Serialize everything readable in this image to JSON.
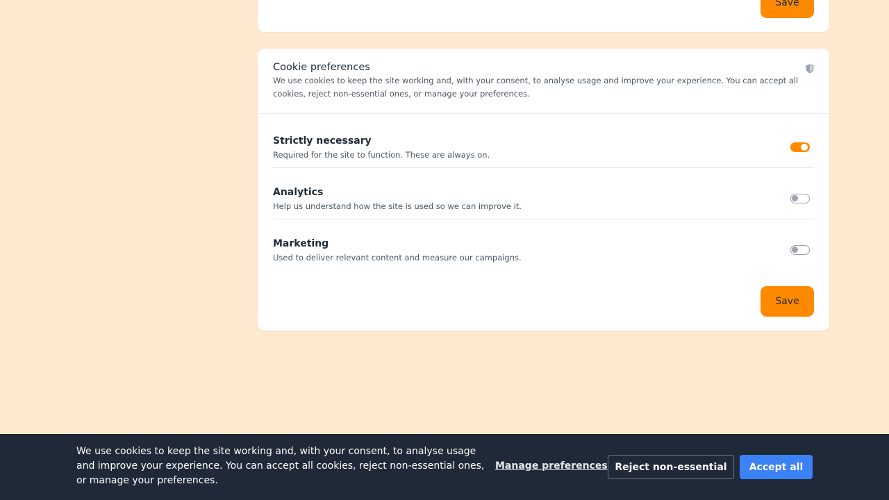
{
  "top_card": {
    "save_label": "Save"
  },
  "cookie_prefs": {
    "title": "Cookie preferences",
    "description": "We use cookies to keep the site working and, with your consent, to analyse usage and improve your experience. You can accept all cookies, reject non-essential ones, or manage your preferences.",
    "icon": "shield-icon",
    "categories": [
      {
        "title": "Strictly necessary",
        "description": "Required for the site to function. These are always on.",
        "enabled": true
      },
      {
        "title": "Analytics",
        "description": "Help us understand how the site is used so we can improve it.",
        "enabled": false
      },
      {
        "title": "Marketing",
        "description": "Used to deliver relevant content and measure our campaigns.",
        "enabled": false
      }
    ],
    "save_label": "Save"
  },
  "banner": {
    "text": "We use cookies to keep the site working and, with your consent, to analyse usage and improve your experience. You can accept all cookies, reject non-essential ones, or manage your preferences.",
    "manage_label": "Manage preferences",
    "reject_label": "Reject non-essential",
    "accept_label": "Accept all"
  },
  "colors": {
    "page_background": "#fee9d0",
    "accent_orange": "#ff8a00",
    "banner_background": "#1f2937",
    "accept_blue": "#3b82f6"
  }
}
